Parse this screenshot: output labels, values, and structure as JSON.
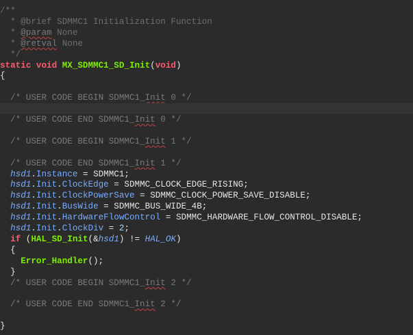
{
  "editor": {
    "lines": [
      {
        "tokens": [
          {
            "t": "/**",
            "c": "doc"
          }
        ]
      },
      {
        "tokens": [
          {
            "t": "  * @brief SDMMC1 Initialization Function",
            "c": "doc"
          }
        ]
      },
      {
        "tokens": [
          {
            "t": "  * ",
            "c": "doc"
          },
          {
            "t": "@param",
            "c": "doctag"
          },
          {
            "t": " None",
            "c": "doc"
          }
        ]
      },
      {
        "tokens": [
          {
            "t": "  * ",
            "c": "doc"
          },
          {
            "t": "@retval",
            "c": "doctag"
          },
          {
            "t": " None",
            "c": "doc"
          }
        ]
      },
      {
        "tokens": [
          {
            "t": "  */",
            "c": "doc"
          }
        ]
      },
      {
        "tokens": [
          {
            "t": "static void ",
            "c": "kw"
          },
          {
            "t": "MX_SDMMC1_SD_Init",
            "c": "fn-def"
          },
          {
            "t": "(",
            "c": "plain"
          },
          {
            "t": "void",
            "c": "kw"
          },
          {
            "t": ")",
            "c": "plain"
          }
        ]
      },
      {
        "tokens": [
          {
            "t": "{",
            "c": "plain"
          }
        ]
      },
      {
        "tokens": []
      },
      {
        "tokens": [
          {
            "t": "  /* USER CODE BEGIN SDMMC1_",
            "c": "comment"
          },
          {
            "t": "Init",
            "c": "comment misspell"
          },
          {
            "t": " 0 */",
            "c": "comment"
          }
        ]
      },
      {
        "tokens": [],
        "current": true
      },
      {
        "tokens": [
          {
            "t": "  /* USER CODE END SDMMC1_",
            "c": "comment"
          },
          {
            "t": "Init",
            "c": "comment misspell"
          },
          {
            "t": " 0 */",
            "c": "comment"
          }
        ]
      },
      {
        "tokens": []
      },
      {
        "tokens": [
          {
            "t": "  /* USER CODE BEGIN SDMMC1_",
            "c": "comment"
          },
          {
            "t": "Init",
            "c": "comment misspell"
          },
          {
            "t": " 1 */",
            "c": "comment"
          }
        ]
      },
      {
        "tokens": []
      },
      {
        "tokens": [
          {
            "t": "  /* USER CODE END SDMMC1_",
            "c": "comment"
          },
          {
            "t": "Init",
            "c": "comment misspell"
          },
          {
            "t": " 1 */",
            "c": "comment"
          }
        ]
      },
      {
        "tokens": [
          {
            "t": "  ",
            "c": "plain"
          },
          {
            "t": "hsd1",
            "c": "var"
          },
          {
            "t": ".",
            "c": "plain"
          },
          {
            "t": "Instance",
            "c": "field"
          },
          {
            "t": " = SDMMC1;",
            "c": "plain"
          }
        ]
      },
      {
        "tokens": [
          {
            "t": "  ",
            "c": "plain"
          },
          {
            "t": "hsd1",
            "c": "var"
          },
          {
            "t": ".",
            "c": "plain"
          },
          {
            "t": "Init",
            "c": "field"
          },
          {
            "t": ".",
            "c": "plain"
          },
          {
            "t": "ClockEdge",
            "c": "field"
          },
          {
            "t": " = SDMMC_CLOCK_EDGE_RISING;",
            "c": "plain"
          }
        ]
      },
      {
        "tokens": [
          {
            "t": "  ",
            "c": "plain"
          },
          {
            "t": "hsd1",
            "c": "var"
          },
          {
            "t": ".",
            "c": "plain"
          },
          {
            "t": "Init",
            "c": "field"
          },
          {
            "t": ".",
            "c": "plain"
          },
          {
            "t": "ClockPowerSave",
            "c": "field"
          },
          {
            "t": " = SDMMC_CLOCK_POWER_SAVE_DISABLE;",
            "c": "plain"
          }
        ]
      },
      {
        "tokens": [
          {
            "t": "  ",
            "c": "plain"
          },
          {
            "t": "hsd1",
            "c": "var"
          },
          {
            "t": ".",
            "c": "plain"
          },
          {
            "t": "Init",
            "c": "field"
          },
          {
            "t": ".",
            "c": "plain"
          },
          {
            "t": "BusWide",
            "c": "field"
          },
          {
            "t": " = SDMMC_BUS_WIDE_4B;",
            "c": "plain"
          }
        ]
      },
      {
        "tokens": [
          {
            "t": "  ",
            "c": "plain"
          },
          {
            "t": "hsd1",
            "c": "var"
          },
          {
            "t": ".",
            "c": "plain"
          },
          {
            "t": "Init",
            "c": "field"
          },
          {
            "t": ".",
            "c": "plain"
          },
          {
            "t": "HardwareFlowControl",
            "c": "field"
          },
          {
            "t": " = SDMMC_HARDWARE_FLOW_CONTROL_DISABLE;",
            "c": "plain"
          }
        ]
      },
      {
        "tokens": [
          {
            "t": "  ",
            "c": "plain"
          },
          {
            "t": "hsd1",
            "c": "var"
          },
          {
            "t": ".",
            "c": "plain"
          },
          {
            "t": "Init",
            "c": "field"
          },
          {
            "t": ".",
            "c": "plain"
          },
          {
            "t": "ClockDiv",
            "c": "field"
          },
          {
            "t": " = ",
            "c": "plain"
          },
          {
            "t": "2",
            "c": "num"
          },
          {
            "t": ";",
            "c": "plain"
          }
        ]
      },
      {
        "tokens": [
          {
            "t": "  ",
            "c": "plain"
          },
          {
            "t": "if",
            "c": "kw"
          },
          {
            "t": " (",
            "c": "plain"
          },
          {
            "t": "HAL_SD_Init",
            "c": "fn"
          },
          {
            "t": "(&",
            "c": "plain"
          },
          {
            "t": "hsd1",
            "c": "var"
          },
          {
            "t": ") != ",
            "c": "plain"
          },
          {
            "t": "HAL_OK",
            "c": "const"
          },
          {
            "t": ")",
            "c": "plain"
          }
        ]
      },
      {
        "tokens": [
          {
            "t": "  {",
            "c": "plain"
          }
        ]
      },
      {
        "tokens": [
          {
            "t": "    ",
            "c": "plain"
          },
          {
            "t": "Error_Handler",
            "c": "fn"
          },
          {
            "t": "();",
            "c": "plain"
          }
        ]
      },
      {
        "tokens": [
          {
            "t": "  }",
            "c": "plain"
          }
        ]
      },
      {
        "tokens": [
          {
            "t": "  /* USER CODE BEGIN SDMMC1_",
            "c": "comment"
          },
          {
            "t": "Init",
            "c": "comment misspell"
          },
          {
            "t": " 2 */",
            "c": "comment"
          }
        ]
      },
      {
        "tokens": []
      },
      {
        "tokens": [
          {
            "t": "  /* USER CODE END SDMMC1_",
            "c": "comment"
          },
          {
            "t": "Init",
            "c": "comment misspell"
          },
          {
            "t": " 2 */",
            "c": "comment"
          }
        ]
      },
      {
        "tokens": []
      },
      {
        "tokens": [
          {
            "t": "}",
            "c": "plain"
          }
        ]
      }
    ]
  }
}
